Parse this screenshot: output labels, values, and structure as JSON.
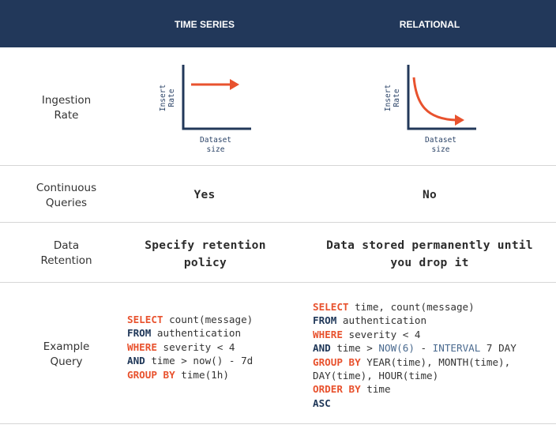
{
  "header": {
    "col1": "TIME SERIES",
    "col2": "RELATIONAL"
  },
  "rows": {
    "ingestion": {
      "label_line1": "Ingestion",
      "label_line2": "Rate",
      "y_axis": [
        "Insert",
        "Rate"
      ],
      "x_axis": [
        "Dataset",
        "size"
      ]
    },
    "continuous": {
      "label_line1": "Continuous",
      "label_line2": "Queries",
      "time_series": "Yes",
      "relational": "No"
    },
    "retention": {
      "label_line1": "Data",
      "label_line2": "Retention",
      "time_series_line1": "Specify retention",
      "time_series_line2": "policy",
      "relational_line1": "Data stored permanently until",
      "relational_line2": "you drop it"
    },
    "query": {
      "label_line1": "Example",
      "label_line2": "Query",
      "ts": {
        "l1_kw": "SELECT",
        "l1_rest": " count(message)",
        "l2_kw": "FROM",
        "l2_rest": " authentication",
        "l3_kw": "WHERE",
        "l3_rest": " severity < 4",
        "l4_kw": "AND",
        "l4_rest": " time > now() - 7d",
        "l5_kw": "GROUP BY",
        "l5_rest": " time(1h)"
      },
      "rel": {
        "l1_kw": "SELECT",
        "l1_rest": " time, count(message)",
        "l2_kw": "FROM",
        "l2_rest": " authentication",
        "l3_kw": "WHERE",
        "l3_rest": " severity < 4",
        "l4_kw": "AND",
        "l4_a": " time > ",
        "l4_fn1": "NOW(6)",
        "l4_b": " - ",
        "l4_fn2": "INTERVAL",
        "l4_c": " 7 DAY",
        "l5_kw": "GROUP BY",
        "l5_rest": " YEAR(time), MONTH(time),",
        "l6_rest": "DAY(time), HOUR(time)",
        "l7_kw": "ORDER BY",
        "l7_rest": " time",
        "l8_kw": "ASC"
      }
    }
  },
  "colors": {
    "header_bg": "#22385a",
    "accent": "#e8522e",
    "axis": "#22385a"
  }
}
